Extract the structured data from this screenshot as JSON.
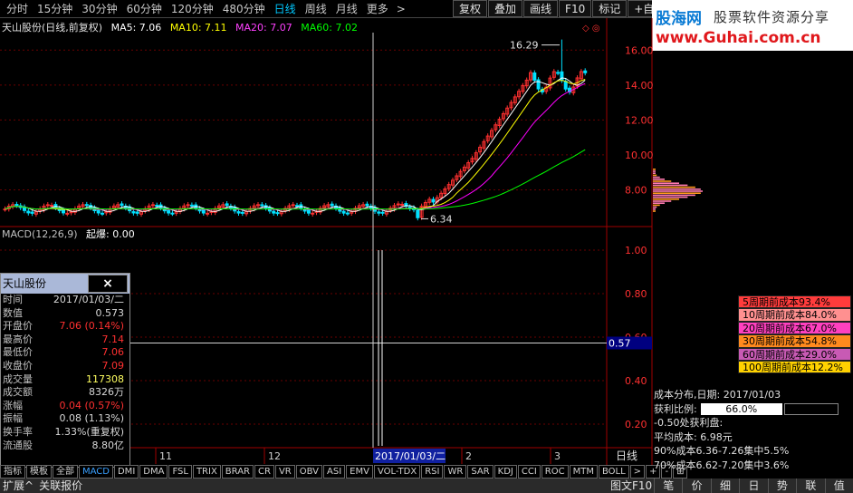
{
  "toolbar": {
    "periods": [
      "分时",
      "15分钟",
      "30分钟",
      "60分钟",
      "120分钟",
      "480分钟",
      "日线",
      "周线",
      "月线",
      "更多"
    ],
    "active_period": "日线",
    "more_arrow": ">",
    "buttons": [
      "复权",
      "叠加",
      "画线",
      "F10",
      "标记",
      "+自选"
    ]
  },
  "banner": {
    "logo": "股海网",
    "slogan": "股票软件资源分享",
    "site": "www.Guhai.com.cn"
  },
  "legend": {
    "name": "天山股份(日线,前复权)",
    "ma5": "MA5: 7.06",
    "ma10": "MA10: 7.11",
    "ma20": "MA20: 7.07",
    "ma60": "MA60: 7.02"
  },
  "main_axis": {
    "ticks": [
      "16.00",
      "14.00",
      "12.00",
      "10.00",
      "8.00"
    ],
    "high_label": "16.29",
    "low_label": "6.34"
  },
  "macd": {
    "legend": "MACD(12,26,9)",
    "signal": "起爆: 0.00",
    "ticks": [
      "1.00",
      "0.80",
      "0.60",
      "0.40",
      "0.20"
    ],
    "cursor_value": "0.57"
  },
  "xaxis": {
    "labels": [
      "11",
      "12",
      "2",
      "3"
    ],
    "cursor_date": "2017/01/03/二",
    "period_label": "日线"
  },
  "infobox": {
    "title": "天山股份",
    "close": "×",
    "rows": [
      {
        "label": "时间",
        "value": "2017/01/03/二",
        "color": "#d8d8d8"
      },
      {
        "label": "数值",
        "value": "0.573",
        "color": "#d8d8d8"
      },
      {
        "label": "开盘价",
        "value": "7.06 (0.14%)",
        "color": "#ff3030"
      },
      {
        "label": "最高价",
        "value": "7.14",
        "color": "#ff3030"
      },
      {
        "label": "最低价",
        "value": "7.06",
        "color": "#ff3030"
      },
      {
        "label": "收盘价",
        "value": "7.09",
        "color": "#ff3030"
      },
      {
        "label": "成交量",
        "value": "117308",
        "color": "#ffff60"
      },
      {
        "label": "成交额",
        "value": "8326万",
        "color": "#d8d8d8"
      },
      {
        "label": "涨幅",
        "value": "0.04 (0.57%)",
        "color": "#ff3030"
      },
      {
        "label": "振幅",
        "value": "0.08 (1.13%)",
        "color": "#d8d8d8"
      },
      {
        "label": "换手率",
        "value": "1.33%(重复权)",
        "color": "#d8d8d8"
      },
      {
        "label": "流通股",
        "value": "8.80亿",
        "color": "#d8d8d8"
      }
    ]
  },
  "indicator_tabs": [
    "指标",
    "模板",
    "全部",
    "MACD",
    "DMI",
    "DMA",
    "FSL",
    "TRIX",
    "BRAR",
    "CR",
    "VR",
    "OBV",
    "ASI",
    "EMV",
    "VOL-TDX",
    "RSI",
    "WR",
    "SAR",
    "KDJ",
    "CCI",
    "ROC",
    "MTM",
    "BOLL",
    ">",
    "+",
    "-",
    "⊞"
  ],
  "active_indicator": "MACD",
  "bottom_bar": {
    "left": [
      "扩展^",
      "关联报价"
    ],
    "right_text": "图文F10"
  },
  "cost_rows": [
    {
      "label": "5周期前成本93.4%",
      "bg": "#ff3c3c"
    },
    {
      "label": "10周期前成本84.0%",
      "bg": "#ff9090"
    },
    {
      "label": "20周期前成本67.0%",
      "bg": "#ff40c0"
    },
    {
      "label": "30周期前成本54.8%",
      "bg": "#ff8a1e"
    },
    {
      "label": "60周期前成本29.0%",
      "bg": "#c85ab4"
    },
    {
      "label": "100周期前成本12.2%",
      "bg": "#ffd200"
    }
  ],
  "cost_info": {
    "date_line": "成本分布,日期: 2017/01/03",
    "profit_label": "获利比例:",
    "profit_value": "66.0%",
    "profit_point": "-0.50处获利盘:",
    "avg_cost": "平均成本: 6.98元",
    "c90": "90%成本6.36-7.26集中5.5%",
    "c70": "70%成本6.62-7.20集中3.6%"
  },
  "right_tabs": [
    "笔",
    "价",
    "细",
    "日",
    "势",
    "联",
    "值"
  ],
  "chart_data": {
    "type": "candlestick",
    "series": [
      {
        "name": "MA5",
        "values": [
          7.06
        ]
      },
      {
        "name": "MA10",
        "values": [
          7.11
        ]
      },
      {
        "name": "MA20",
        "values": [
          7.07
        ]
      },
      {
        "name": "MA60",
        "values": [
          7.02
        ]
      }
    ],
    "colors": {
      "up": "#ff3030",
      "down": "#00e0ff",
      "ma5": "#ffffff",
      "ma10": "#ffff00",
      "ma20": "#ff00ff",
      "ma60": "#00ff00"
    },
    "ylim": [
      6.0,
      17.0
    ],
    "macd_ylim": [
      0.1,
      1.05
    ]
  }
}
